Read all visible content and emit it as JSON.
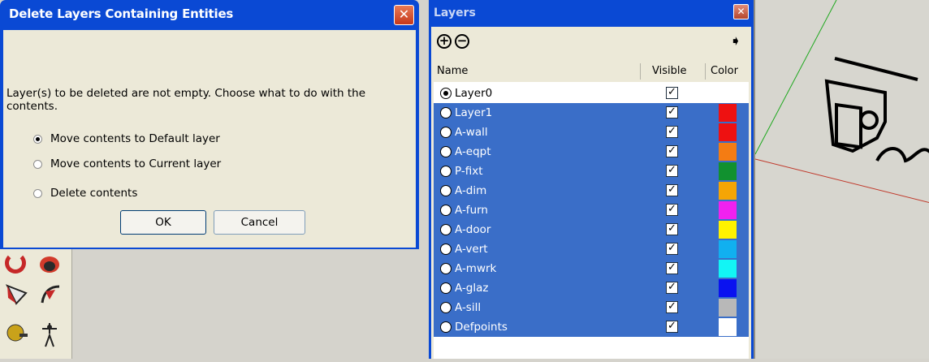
{
  "dialog": {
    "title": "Delete Layers Containing Entities",
    "message": "Layer(s) to be deleted are not empty.  Choose what to do with the contents.",
    "options": [
      {
        "label": "Move contents to Default layer",
        "selected": true
      },
      {
        "label": "Move contents to Current layer",
        "selected": false
      },
      {
        "label": "Delete contents",
        "selected": false
      }
    ],
    "ok_label": "OK",
    "cancel_label": "Cancel",
    "close_glyph": "✕"
  },
  "layers_panel": {
    "title": "Layers",
    "close_glyph": "✕",
    "add_icon": "plus-circle-icon",
    "remove_icon": "minus-circle-icon",
    "details_icon": "details-arrow-icon",
    "columns": {
      "name": "Name",
      "visible": "Visible",
      "color": "Color"
    },
    "layers": [
      {
        "name": "Layer0",
        "current": true,
        "selected": false,
        "visible": true,
        "color": "#ffffff"
      },
      {
        "name": "Layer1",
        "current": false,
        "selected": true,
        "visible": true,
        "color": "#ee1111"
      },
      {
        "name": "A-wall",
        "current": false,
        "selected": true,
        "visible": true,
        "color": "#ee1111"
      },
      {
        "name": "A-eqpt",
        "current": false,
        "selected": true,
        "visible": true,
        "color": "#f47c13"
      },
      {
        "name": "P-fixt",
        "current": false,
        "selected": true,
        "visible": true,
        "color": "#11912f"
      },
      {
        "name": "A-dim",
        "current": false,
        "selected": true,
        "visible": true,
        "color": "#f5a505"
      },
      {
        "name": "A-furn",
        "current": false,
        "selected": true,
        "visible": true,
        "color": "#f021f0"
      },
      {
        "name": "A-door",
        "current": false,
        "selected": true,
        "visible": true,
        "color": "#fff200"
      },
      {
        "name": "A-vert",
        "current": false,
        "selected": true,
        "visible": true,
        "color": "#11b0f0"
      },
      {
        "name": "A-mwrk",
        "current": false,
        "selected": true,
        "visible": true,
        "color": "#12f5f5"
      },
      {
        "name": "A-glaz",
        "current": false,
        "selected": true,
        "visible": true,
        "color": "#0a12f0"
      },
      {
        "name": "A-sill",
        "current": false,
        "selected": true,
        "visible": true,
        "color": "#b8b8b8"
      },
      {
        "name": "Defpoints",
        "current": false,
        "selected": true,
        "visible": true,
        "color": "#ffffff"
      }
    ]
  },
  "colors": {
    "title_bar": "#0a49d4",
    "selection": "#3a6ec8",
    "dialog_face": "#ece9d8"
  }
}
